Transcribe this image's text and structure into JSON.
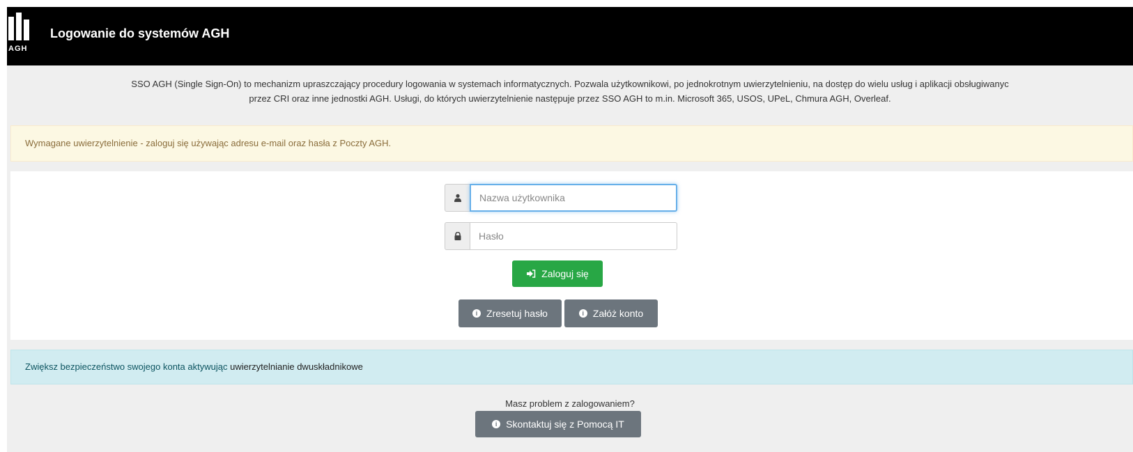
{
  "header": {
    "logo_text": "AGH",
    "title": "Logowanie do systemów AGH"
  },
  "intro": {
    "line1": "SSO AGH (Single Sign-On) to mechanizm upraszczający procedury logowania w systemach informatycznych. Pozwala użytkownikowi, po jednokrotnym uwierzytelnieniu, na dostęp do wielu usług i aplikacji obsługiwanyc",
    "line2": "przez CRI oraz inne jednostki AGH. Usługi, do których uwierzytelnienie następuje przez SSO AGH to m.in. Microsoft 365, USOS, UPeL, Chmura AGH, Overleaf."
  },
  "warning": {
    "text": "Wymagane uwierzytelnienie - zaloguj się używając adresu e-mail oraz hasła z Poczty AGH."
  },
  "login_form": {
    "username_placeholder": "Nazwa użytkownika",
    "username_value": "",
    "password_placeholder": "Hasło",
    "password_value": "",
    "login_button": "Zaloguj się",
    "reset_button": "Zresetuj hasło",
    "create_account_button": "Załóż konto"
  },
  "security_info": {
    "text": "Zwiększ bezpieczeństwo swojego konta aktywując ",
    "link": "uwierzytelnianie dwuskładnikowe"
  },
  "help": {
    "question": "Masz problem z zalogowaniem?",
    "button": "Skontaktuj się z Pomocą IT"
  },
  "icons": {
    "user": "user-icon",
    "lock": "lock-icon",
    "login": "sign-in-icon",
    "info": "info-circle-icon"
  },
  "colors": {
    "header_bg": "#000000",
    "success": "#28a745",
    "secondary": "#6c757d",
    "warning_bg": "#fcf8e3",
    "info_bg": "#d1ecf1"
  }
}
